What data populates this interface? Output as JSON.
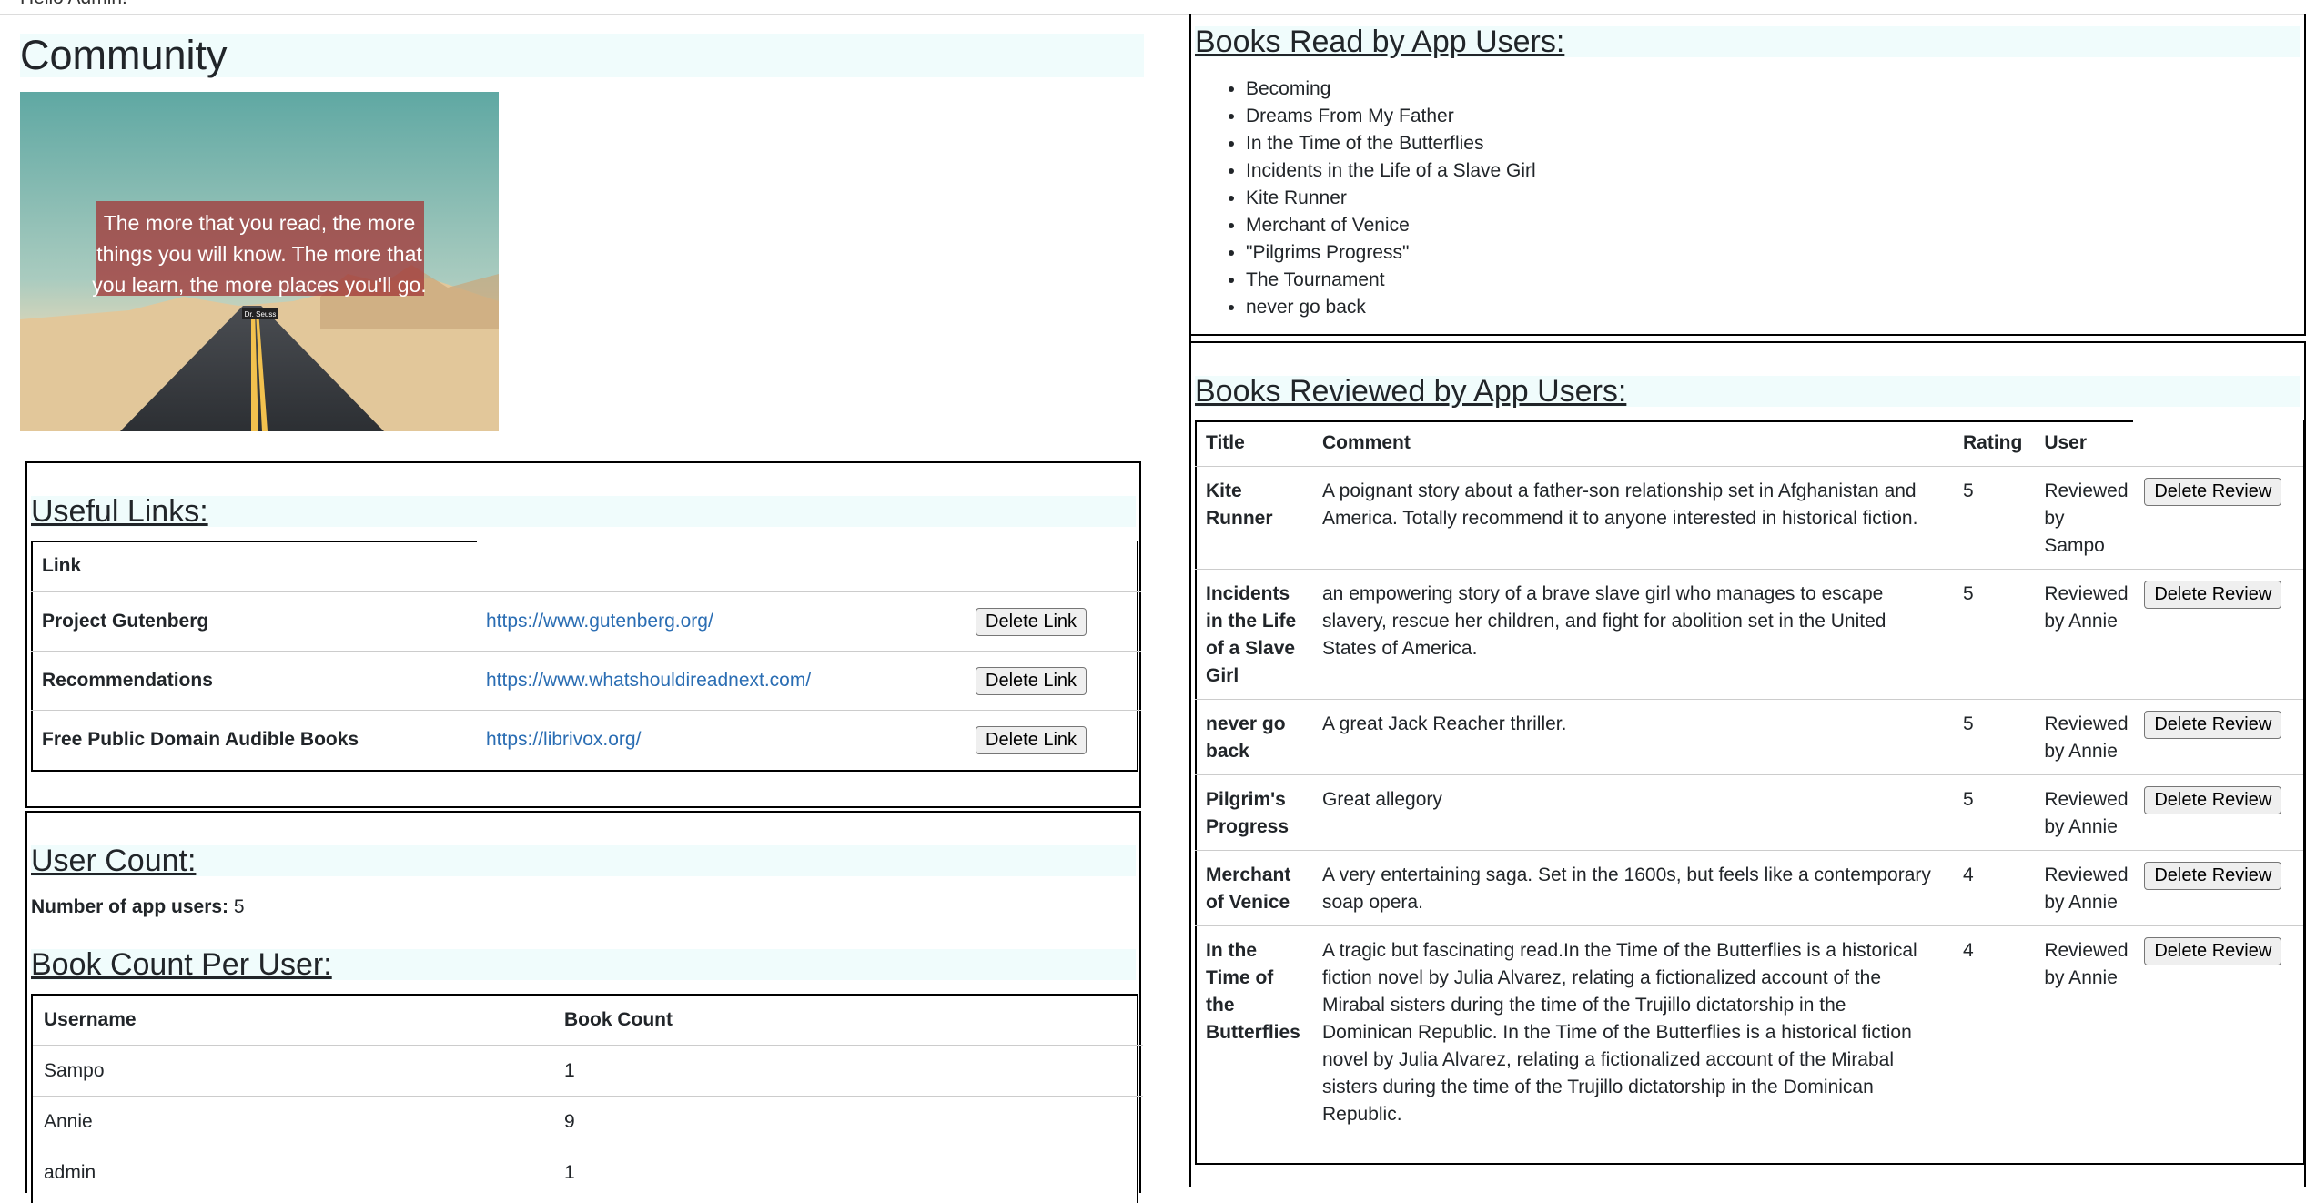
{
  "header": {
    "greeting": "Hello Admin!"
  },
  "page": {
    "title": "Community"
  },
  "quote_image": {
    "text_line1": "The more that you read, the more",
    "text_line2": "things you will know. The more that",
    "text_line3": "you learn, the more places you'll go.",
    "author": "Dr. Seuss"
  },
  "useful_links": {
    "heading": "Useful Links:",
    "column_header": "Link",
    "delete_label": "Delete Link",
    "rows": [
      {
        "name": "Project Gutenberg",
        "url": "https://www.gutenberg.org/"
      },
      {
        "name": "Recommendations",
        "url": "https://www.whatshouldireadnext.com/"
      },
      {
        "name": "Free Public Domain Audible Books",
        "url": "https://librivox.org/"
      }
    ]
  },
  "user_count": {
    "heading": "User Count:",
    "label": "Number of app users:",
    "value": "5"
  },
  "book_count": {
    "heading": "Book Count Per User:",
    "columns": [
      "Username",
      "Book Count"
    ],
    "rows": [
      {
        "username": "Sampo",
        "count": "1"
      },
      {
        "username": "Annie",
        "count": "9"
      },
      {
        "username": "admin",
        "count": "1"
      }
    ]
  },
  "books_read": {
    "heading": "Books Read by App Users:",
    "items": [
      "Becoming",
      "Dreams From My Father",
      "In the Time of the Butterflies",
      "Incidents in the Life of a Slave Girl",
      "Kite Runner",
      "Merchant of Venice",
      "\"Pilgrims Progress\"",
      "The Tournament",
      "never go back"
    ]
  },
  "books_reviewed": {
    "heading": "Books Reviewed by App Users:",
    "columns": [
      "Title",
      "Comment",
      "Rating",
      "User"
    ],
    "delete_label": "Delete Review",
    "rows": [
      {
        "title": "Kite Runner",
        "comment": "A poignant story about a father-son relationship set in Afghanistan and America. Totally recommend it to anyone interested in historical fiction.",
        "rating": "5",
        "user": "Reviewed by Sampo"
      },
      {
        "title": "Incidents in the Life of a Slave Girl",
        "comment": "an empowering story of a brave slave girl who manages to escape slavery, rescue her children, and fight for abolition set in the United States of America.",
        "rating": "5",
        "user": "Reviewed by Annie"
      },
      {
        "title": "never go back",
        "comment": "A great Jack Reacher thriller.",
        "rating": "5",
        "user": "Reviewed by Annie"
      },
      {
        "title": "Pilgrim's Progress",
        "comment": "Great allegory",
        "rating": "5",
        "user": "Reviewed by Annie"
      },
      {
        "title": "Merchant of Venice",
        "comment": "A very entertaining saga. Set in the 1600s, but feels like a contemporary soap opera.",
        "rating": "4",
        "user": "Reviewed by Annie"
      },
      {
        "title": "In the Time of the Butterflies",
        "comment": "A tragic but fascinating read.In the Time of the Butterflies is a historical fiction novel by Julia Alvarez, relating a fictionalized account of the Mirabal sisters during the time of the Trujillo dictatorship in the Dominican Republic. In the Time of the Butterflies is a historical fiction novel by Julia Alvarez, relating a fictionalized account of the Mirabal sisters during the time of the Trujillo dictatorship in the Dominican Republic.",
        "rating": "4",
        "user": "Reviewed by Annie"
      }
    ]
  }
}
